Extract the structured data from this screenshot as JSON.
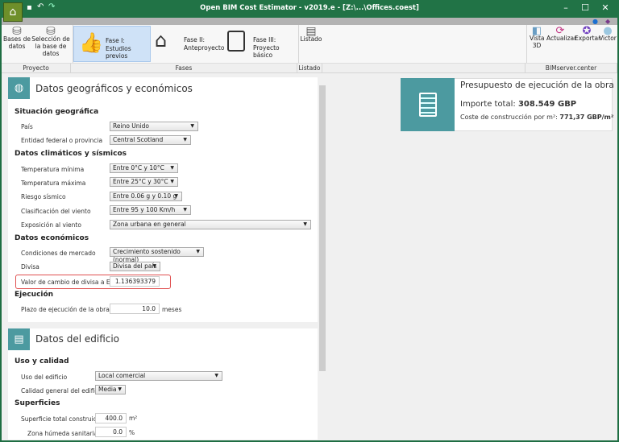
{
  "window": {
    "title": "Open BIM Cost Estimator - v2019.e - [Z:\\...\\Offices.coest]",
    "minimize": "–",
    "maximize": "☐",
    "close": "✕"
  },
  "ribbon": {
    "groups": {
      "proyecto": "Proyecto",
      "fases": "Fases",
      "listado": "Listado",
      "bimserver": "BIMserver.center"
    },
    "bases_datos": "Bases de datos",
    "seleccion_base": "Selección de la base de datos",
    "fase1_title": "Fase I:",
    "fase1_sub": "Estudios previos",
    "fase2_title": "Fase II:",
    "fase2_sub": "Anteproyecto",
    "fase3_title": "Fase III:",
    "fase3_sub": "Proyecto básico",
    "listado": "Listado",
    "vista3d": "Vista 3D",
    "actualizar": "Actualizar",
    "exportar": "Exportar",
    "user": "Victor"
  },
  "geo": {
    "title": "Datos geográficos y económicos",
    "situacion": "Situación geográfica",
    "pais_label": "País",
    "pais": "Reino Unido",
    "entidad_label": "Entidad federal o provincia",
    "entidad": "Central Scotland",
    "climaticos": "Datos climáticos y sísmicos",
    "tmin_label": "Temperatura mínima",
    "tmin": "Entre 0°C y 10°C",
    "tmax_label": "Temperatura máxima",
    "tmax": "Entre 25°C y 30°C",
    "riesgo_label": "Riesgo sísmico",
    "riesgo": "Entre 0.06 g y 0.10 g",
    "viento_label": "Clasificación del viento",
    "viento": "Entre 95 y 100 Km/h",
    "expo_label": "Exposición al viento",
    "expo": "Zona urbana en general",
    "economicos": "Datos económicos",
    "mercado_label": "Condiciones de mercado",
    "mercado": "Crecimiento sostenido (normal)",
    "divisa_label": "Divisa",
    "divisa": "Divisa del país",
    "cambio_label": "Valor de cambio de divisa a Euro",
    "cambio": "1.136393379",
    "ejecucion": "Ejecución",
    "plazo_label": "Plazo de ejecución de la obra",
    "plazo": "10.0",
    "plazo_unit": "meses"
  },
  "edificio": {
    "title": "Datos del edificio",
    "uso_calidad": "Uso y calidad",
    "uso_label": "Uso del edificio",
    "uso": "Local comercial",
    "calidad_label": "Calidad general del edificio",
    "calidad": "Media",
    "superficies": "Superficies",
    "sup_label": "Superficie total construida",
    "sup": "400.0",
    "sup_unit": "m²",
    "zona_label": "Zona húmeda sanitaria",
    "zona": "0.0",
    "zona_unit": "%"
  },
  "presupuesto": {
    "title": "Presupuesto de ejecución de la obra",
    "importe_label": "Importe total:",
    "importe": "308.549 GBP",
    "coste_label": "Coste de construcción por m²:",
    "coste": "771,37 GBP/m²"
  },
  "colors": {
    "accent": "#217346",
    "teal": "#4c9aa0",
    "highlight": "#e05050"
  }
}
